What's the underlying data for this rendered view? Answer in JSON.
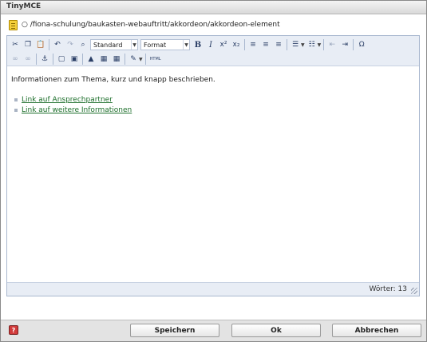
{
  "window": {
    "title": "TinyMCE"
  },
  "path": {
    "text": "○ /fiona-schulung/baukasten-webauftritt/akkordeon/akkordeon-element"
  },
  "toolbar": {
    "format_block_label": "Standard",
    "format_label": "Format",
    "html_label": "HTML",
    "special_char_label": "Ω"
  },
  "content": {
    "paragraph": "Informationen zum Thema, kurz und knapp beschrieben.",
    "links": [
      {
        "label": "Link auf Ansprechpartner"
      },
      {
        "label": "Link auf weitere Informationen"
      }
    ]
  },
  "status": {
    "word_count": "Wörter: 13"
  },
  "footer": {
    "save_label": "Speichern",
    "ok_label": "Ok",
    "cancel_label": "Abbrechen"
  }
}
